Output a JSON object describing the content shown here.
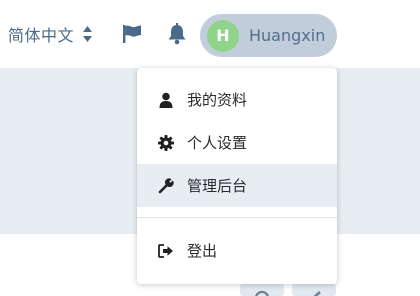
{
  "header": {
    "language_label": "简体中文",
    "user_name": "Huangxin",
    "avatar_initial": "H"
  },
  "user_menu": {
    "items": [
      {
        "label": "我的资料",
        "icon": "user-icon"
      },
      {
        "label": "个人设置",
        "icon": "gear-icon"
      },
      {
        "label": "管理后台",
        "icon": "wrench-icon"
      },
      {
        "label": "登出",
        "icon": "sign-out-icon"
      }
    ]
  },
  "colors": {
    "avatar": "#8fd48a",
    "user_pill": "#c2cddb",
    "header_icons": "#4a6a8c",
    "content_band": "#e8edf3"
  }
}
